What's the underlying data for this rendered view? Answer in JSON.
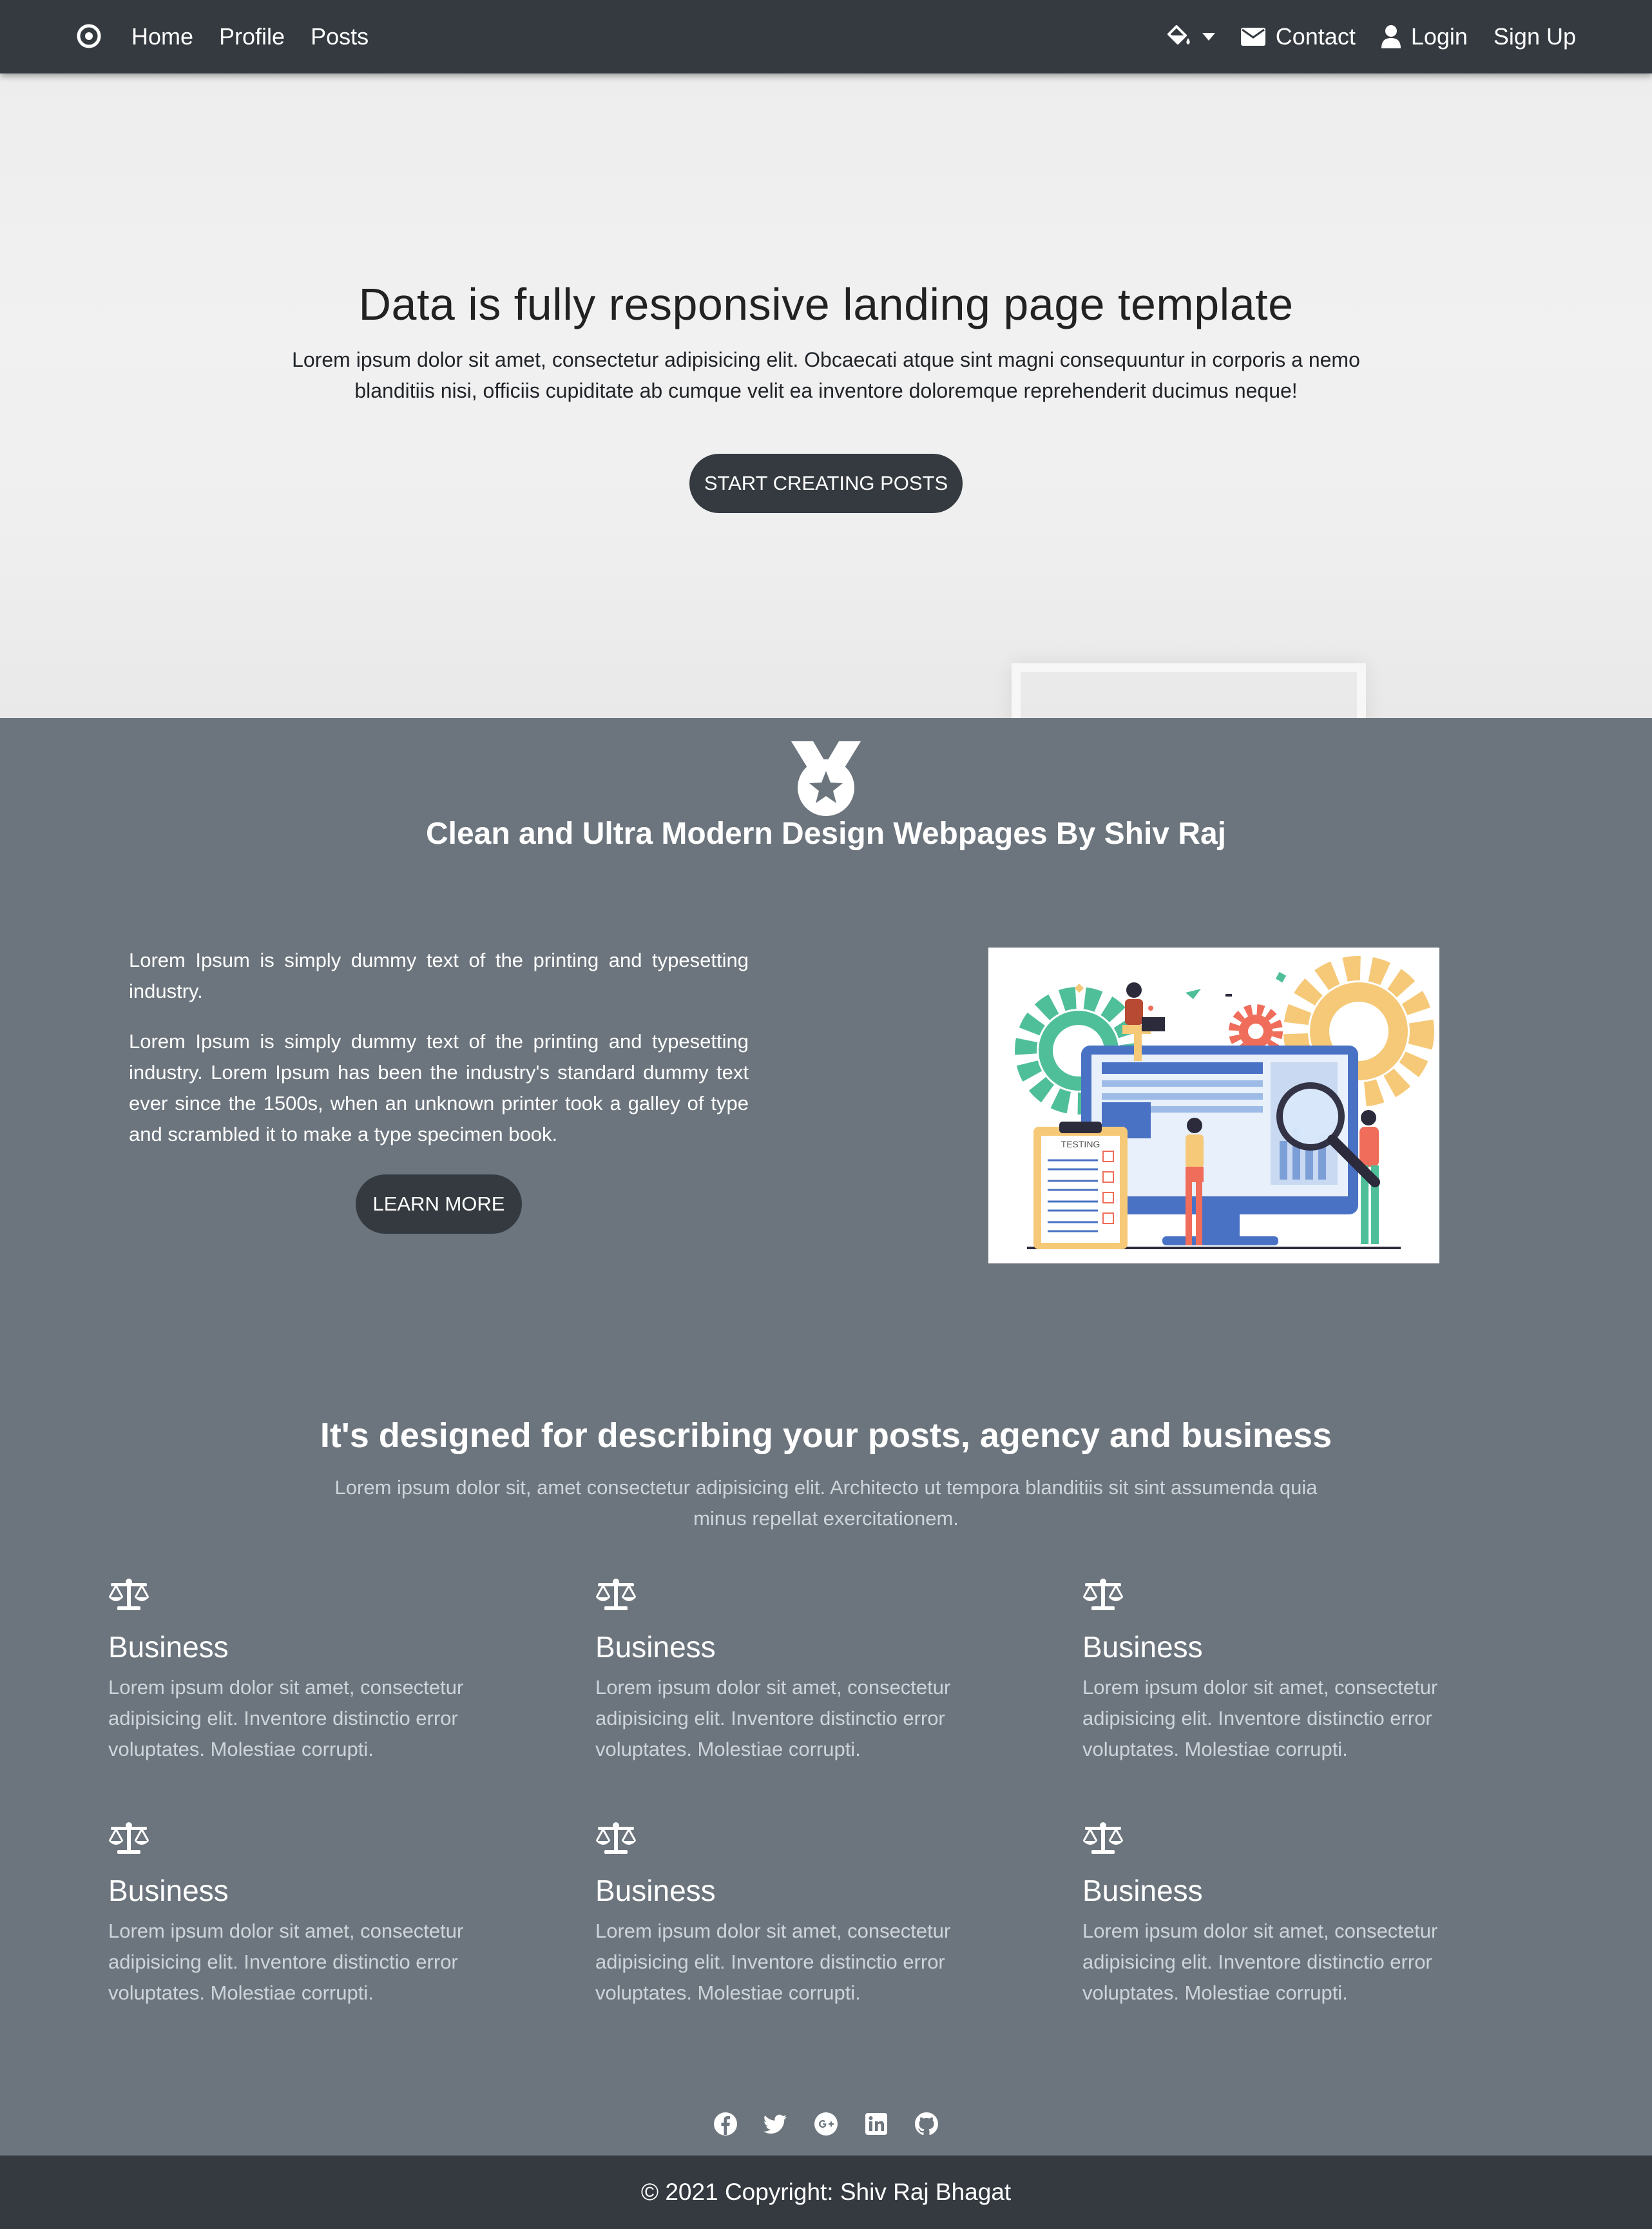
{
  "nav": {
    "brand_icon": "target-icon",
    "links": [
      "Home",
      "Profile",
      "Posts"
    ],
    "theme_icon": "paint-bucket-icon",
    "contact": "Contact",
    "login": "Login",
    "signup": "Sign Up"
  },
  "hero": {
    "title": "Data is fully responsive landing page template",
    "subtitle": "Lorem ipsum dolor sit amet, consectetur adipisicing elit. Obcaecati atque sint magni consequuntur in corporis a nemo blanditiis nisi, officiis cupiditate ab cumque velit ea inventore doloremque reprehenderit ducimus neque!",
    "button": "START CREATING POSTS"
  },
  "feature": {
    "icon": "medal-icon",
    "title": "Clean and Ultra Modern Design Webpages By Shiv Raj"
  },
  "about": {
    "p1": "Lorem Ipsum is simply dummy text of the printing and typesetting industry.",
    "p2": "Lorem Ipsum is simply dummy text of the printing and typesetting industry. Lorem Ipsum has been the industry's standard dummy text ever since the 1500s, when an unknown printer took a galley of type and scrambled it to make a type specimen book.",
    "button": "LEARN MORE",
    "illustration_label": "TESTING"
  },
  "services": {
    "title": "It's designed for describing your posts, agency and business",
    "subtitle": "Lorem ipsum dolor sit, amet consectetur adipisicing elit. Architecto ut tempora blanditiis sit sint assumenda quia minus repellat exercitationem.",
    "items": [
      {
        "icon": "balance-scale-icon",
        "title": "Business",
        "text": "Lorem ipsum dolor sit amet, consectetur adipisicing elit. Inventore distinctio error voluptates. Molestiae corrupti."
      },
      {
        "icon": "balance-scale-icon",
        "title": "Business",
        "text": "Lorem ipsum dolor sit amet, consectetur adipisicing elit. Inventore distinctio error voluptates. Molestiae corrupti."
      },
      {
        "icon": "balance-scale-icon",
        "title": "Business",
        "text": "Lorem ipsum dolor sit amet, consectetur adipisicing elit. Inventore distinctio error voluptates. Molestiae corrupti."
      },
      {
        "icon": "balance-scale-icon",
        "title": "Business",
        "text": "Lorem ipsum dolor sit amet, consectetur adipisicing elit. Inventore distinctio error voluptates. Molestiae corrupti."
      },
      {
        "icon": "balance-scale-icon",
        "title": "Business",
        "text": "Lorem ipsum dolor sit amet, consectetur adipisicing elit. Inventore distinctio error voluptates. Molestiae corrupti."
      },
      {
        "icon": "balance-scale-icon",
        "title": "Business",
        "text": "Lorem ipsum dolor sit amet, consectetur adipisicing elit. Inventore distinctio error voluptates. Molestiae corrupti."
      }
    ]
  },
  "social_icons": [
    "facebook-icon",
    "twitter-icon",
    "google-plus-icon",
    "linkedin-icon",
    "github-icon"
  ],
  "footer": {
    "copyright": "© 2021 Copyright: Shiv Raj Bhagat"
  },
  "colors": {
    "navbar": "#343a40",
    "body": "#6c757d",
    "muted_text": "#ced4da",
    "hero_bg": "#efefef"
  }
}
